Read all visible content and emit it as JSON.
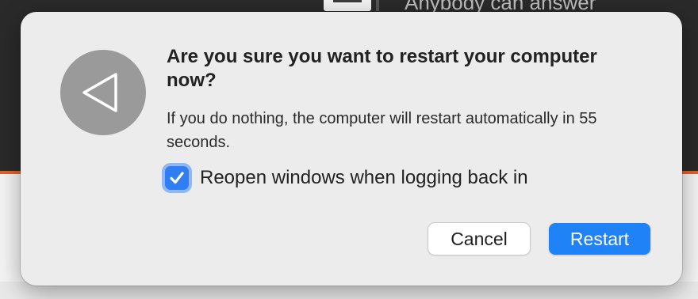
{
  "background": {
    "partial_text": "Anybody can answer"
  },
  "dialog": {
    "icon": "back-triangle-icon",
    "title": "Are you sure you want to restart your computer now?",
    "message": "If you do nothing, the computer will restart automatically in 55 seconds.",
    "checkbox": {
      "label": "Reopen windows when logging back in",
      "checked": true
    },
    "buttons": {
      "cancel_label": "Cancel",
      "restart_label": "Restart"
    }
  },
  "colors": {
    "accent": "#1f83f7",
    "checkbox_focus": "#8fb7f5",
    "dialog_bg": "#ececec"
  }
}
